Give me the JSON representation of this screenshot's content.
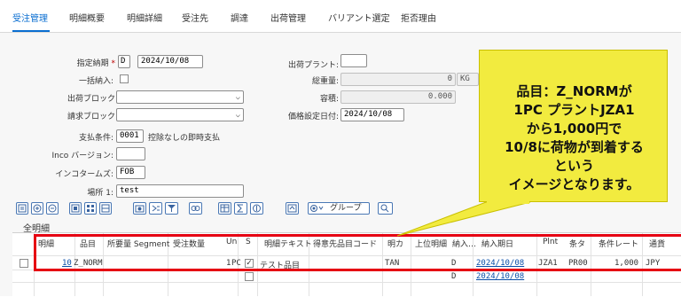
{
  "tabs": [
    "受注管理",
    "明細概要",
    "明細詳細",
    "受注先",
    "調達",
    "出荷管理",
    "バリアント選定",
    "拒否理由"
  ],
  "form": {
    "delivery_date_label": "指定納期",
    "delivery_date_type": "D",
    "delivery_date": "2024/10/08",
    "bulk_delivery_label": "一括納入:",
    "shipping_block_label": "出荷ブロック",
    "billing_block_label": "請求ブロック",
    "payment_terms_label": "支払条件:",
    "payment_terms_code": "0001",
    "payment_terms_text": "控除なしの即時支払",
    "inco_version_label": "Inco バージョン:",
    "incoterms_label": "インコタームズ:",
    "incoterms_value": "FOB",
    "location1_label": "場所 1:",
    "location1_value": "test",
    "shipping_plant_label": "出荷プラント:",
    "gross_weight_label": "総重量:",
    "gross_weight_value": "0",
    "gross_weight_unit": "KG",
    "volume_label": "容積:",
    "volume_value": "0.000",
    "pricing_date_label": "価格設定日付:",
    "pricing_date_value": "2024/10/08"
  },
  "toolbar": {
    "group_label": "グループ"
  },
  "table": {
    "title": "全明細",
    "columns": [
      "明細",
      "品目",
      "所要量 Segment",
      "受注数量",
      "Un",
      "S",
      "明細テキスト",
      "得意先品目コード",
      "明カ",
      "上位明細",
      "納入…",
      "納入期日",
      "Plnt",
      "条タ",
      "条件レート",
      "通貨"
    ],
    "rows": [
      {
        "item": "10",
        "material": "Z_NORM",
        "quantity": "1",
        "unit": "PC",
        "text": "テスト品目",
        "category": "TAN",
        "date_type": "D",
        "delivery_date": "2024/10/08",
        "plant": "JZA1",
        "cond_type": "PR00",
        "rate": "1,000",
        "currency": "JPY"
      },
      {
        "date_type": "D",
        "delivery_date": "2024/10/08"
      }
    ]
  },
  "callout": {
    "lines": [
      "品目：Z_NORMが",
      "1PC プラントJZA1",
      "から1,000円で",
      "10/8に荷物が到着する",
      "という",
      "イメージとなります。"
    ]
  },
  "colors": {
    "accent": "#0a6ed1",
    "highlight_box": "#e60012",
    "callout_bg": "#f2eb3f"
  }
}
